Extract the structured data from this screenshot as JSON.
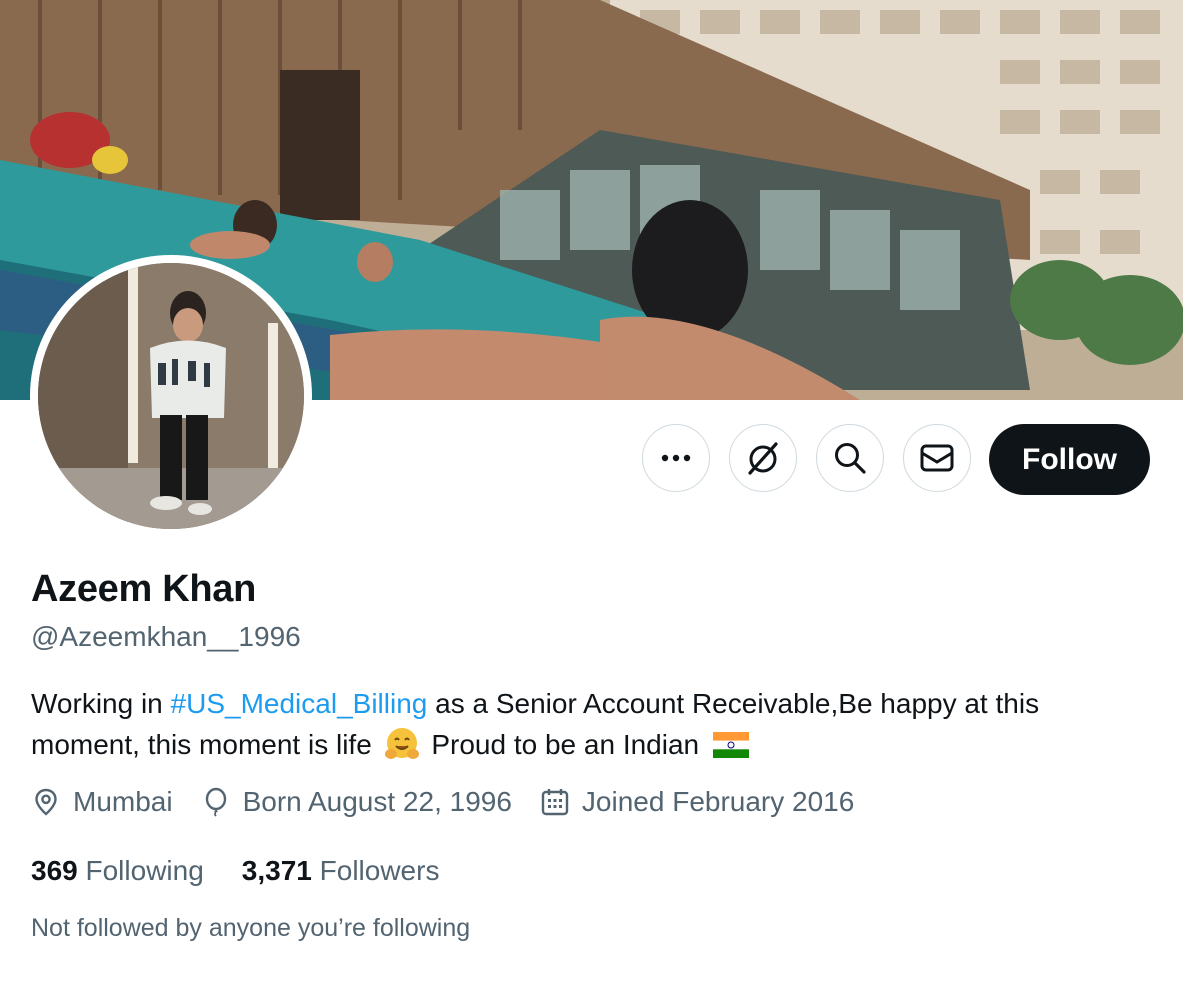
{
  "profile": {
    "name": "Azeem Khan",
    "handle": "@Azeemkhan__1996",
    "bio": {
      "prefix": "Working in ",
      "hashtag": "#US_Medical_Billing",
      "middle": " as a Senior Account Receivable,Be happy at this moment, this moment is life",
      "emoji": "hugging-face",
      "suffix": " Proud to be an Indian",
      "flag": "india-flag"
    },
    "location": "Mumbai",
    "birthday": "Born August 22, 1996",
    "joined": "Joined February 2016",
    "following_count": "369",
    "following_label": "Following",
    "followers_count": "3,371",
    "followers_label": "Followers",
    "mutuals_note": "Not followed by anyone you’re following"
  },
  "actions": {
    "more": "more-icon",
    "grok": "grok-icon",
    "search": "search-icon",
    "message": "mail-icon",
    "follow_label": "Follow"
  },
  "colors": {
    "link": "#1d9bf0",
    "primary_text": "#0f1419",
    "secondary_text": "#536471",
    "button_dark": "#0f1419"
  }
}
